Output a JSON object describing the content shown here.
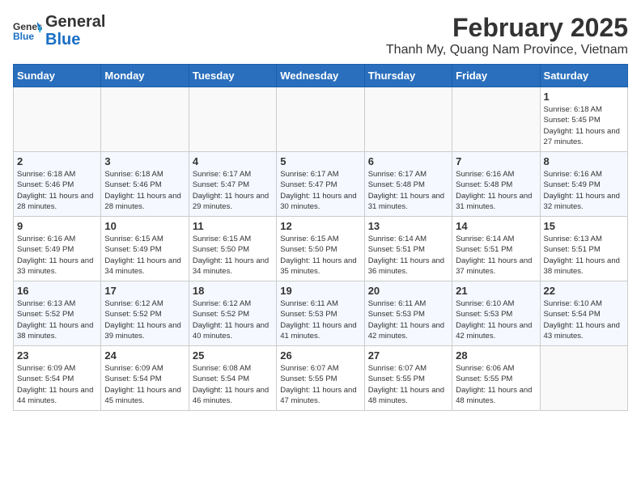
{
  "header": {
    "logo_general": "General",
    "logo_blue": "Blue",
    "month_title": "February 2025",
    "location": "Thanh My, Quang Nam Province, Vietnam"
  },
  "weekdays": [
    "Sunday",
    "Monday",
    "Tuesday",
    "Wednesday",
    "Thursday",
    "Friday",
    "Saturday"
  ],
  "weeks": [
    [
      {
        "day": "",
        "info": ""
      },
      {
        "day": "",
        "info": ""
      },
      {
        "day": "",
        "info": ""
      },
      {
        "day": "",
        "info": ""
      },
      {
        "day": "",
        "info": ""
      },
      {
        "day": "",
        "info": ""
      },
      {
        "day": "1",
        "info": "Sunrise: 6:18 AM\nSunset: 5:45 PM\nDaylight: 11 hours\nand 27 minutes."
      }
    ],
    [
      {
        "day": "2",
        "info": "Sunrise: 6:18 AM\nSunset: 5:46 PM\nDaylight: 11 hours\nand 28 minutes."
      },
      {
        "day": "3",
        "info": "Sunrise: 6:18 AM\nSunset: 5:46 PM\nDaylight: 11 hours\nand 28 minutes."
      },
      {
        "day": "4",
        "info": "Sunrise: 6:17 AM\nSunset: 5:47 PM\nDaylight: 11 hours\nand 29 minutes."
      },
      {
        "day": "5",
        "info": "Sunrise: 6:17 AM\nSunset: 5:47 PM\nDaylight: 11 hours\nand 30 minutes."
      },
      {
        "day": "6",
        "info": "Sunrise: 6:17 AM\nSunset: 5:48 PM\nDaylight: 11 hours\nand 31 minutes."
      },
      {
        "day": "7",
        "info": "Sunrise: 6:16 AM\nSunset: 5:48 PM\nDaylight: 11 hours\nand 31 minutes."
      },
      {
        "day": "8",
        "info": "Sunrise: 6:16 AM\nSunset: 5:49 PM\nDaylight: 11 hours\nand 32 minutes."
      }
    ],
    [
      {
        "day": "9",
        "info": "Sunrise: 6:16 AM\nSunset: 5:49 PM\nDaylight: 11 hours\nand 33 minutes."
      },
      {
        "day": "10",
        "info": "Sunrise: 6:15 AM\nSunset: 5:49 PM\nDaylight: 11 hours\nand 34 minutes."
      },
      {
        "day": "11",
        "info": "Sunrise: 6:15 AM\nSunset: 5:50 PM\nDaylight: 11 hours\nand 34 minutes."
      },
      {
        "day": "12",
        "info": "Sunrise: 6:15 AM\nSunset: 5:50 PM\nDaylight: 11 hours\nand 35 minutes."
      },
      {
        "day": "13",
        "info": "Sunrise: 6:14 AM\nSunset: 5:51 PM\nDaylight: 11 hours\nand 36 minutes."
      },
      {
        "day": "14",
        "info": "Sunrise: 6:14 AM\nSunset: 5:51 PM\nDaylight: 11 hours\nand 37 minutes."
      },
      {
        "day": "15",
        "info": "Sunrise: 6:13 AM\nSunset: 5:51 PM\nDaylight: 11 hours\nand 38 minutes."
      }
    ],
    [
      {
        "day": "16",
        "info": "Sunrise: 6:13 AM\nSunset: 5:52 PM\nDaylight: 11 hours\nand 38 minutes."
      },
      {
        "day": "17",
        "info": "Sunrise: 6:12 AM\nSunset: 5:52 PM\nDaylight: 11 hours\nand 39 minutes."
      },
      {
        "day": "18",
        "info": "Sunrise: 6:12 AM\nSunset: 5:52 PM\nDaylight: 11 hours\nand 40 minutes."
      },
      {
        "day": "19",
        "info": "Sunrise: 6:11 AM\nSunset: 5:53 PM\nDaylight: 11 hours\nand 41 minutes."
      },
      {
        "day": "20",
        "info": "Sunrise: 6:11 AM\nSunset: 5:53 PM\nDaylight: 11 hours\nand 42 minutes."
      },
      {
        "day": "21",
        "info": "Sunrise: 6:10 AM\nSunset: 5:53 PM\nDaylight: 11 hours\nand 42 minutes."
      },
      {
        "day": "22",
        "info": "Sunrise: 6:10 AM\nSunset: 5:54 PM\nDaylight: 11 hours\nand 43 minutes."
      }
    ],
    [
      {
        "day": "23",
        "info": "Sunrise: 6:09 AM\nSunset: 5:54 PM\nDaylight: 11 hours\nand 44 minutes."
      },
      {
        "day": "24",
        "info": "Sunrise: 6:09 AM\nSunset: 5:54 PM\nDaylight: 11 hours\nand 45 minutes."
      },
      {
        "day": "25",
        "info": "Sunrise: 6:08 AM\nSunset: 5:54 PM\nDaylight: 11 hours\nand 46 minutes."
      },
      {
        "day": "26",
        "info": "Sunrise: 6:07 AM\nSunset: 5:55 PM\nDaylight: 11 hours\nand 47 minutes."
      },
      {
        "day": "27",
        "info": "Sunrise: 6:07 AM\nSunset: 5:55 PM\nDaylight: 11 hours\nand 48 minutes."
      },
      {
        "day": "28",
        "info": "Sunrise: 6:06 AM\nSunset: 5:55 PM\nDaylight: 11 hours\nand 48 minutes."
      },
      {
        "day": "",
        "info": ""
      }
    ]
  ]
}
